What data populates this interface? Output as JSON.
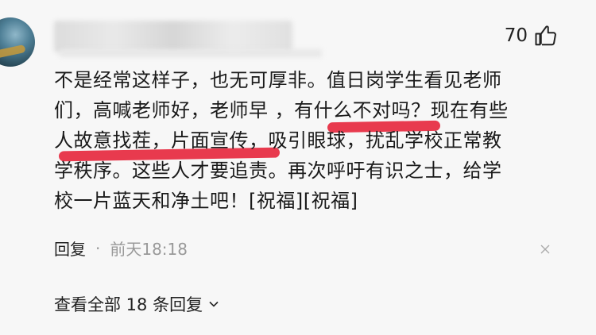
{
  "comment": {
    "like_count": "70",
    "lines": [
      "不是经常这样子，也无可厚非。值日岗学生看见老师",
      "们，高喊老师好，老师早 ，有什么不对吗？现在有些",
      "人故意找茬，片面宣传，吸引眼球，扰乱学校正常教",
      "学秩序。这些人才要追责。再次呼吁有识之士，给学",
      "校一片蓝天和净土吧！[祝福][祝福]"
    ],
    "reply_label": "回复",
    "separator": "·",
    "timestamp": "前天18:18",
    "view_all_label": "查看全部 18 条回复"
  },
  "icons": {
    "like": "thumbs-up-icon",
    "close": "close-icon",
    "expand": "chevron-down-icon"
  },
  "colors": {
    "highlight_underline": "#e83a4e",
    "meta_text": "#999999"
  }
}
